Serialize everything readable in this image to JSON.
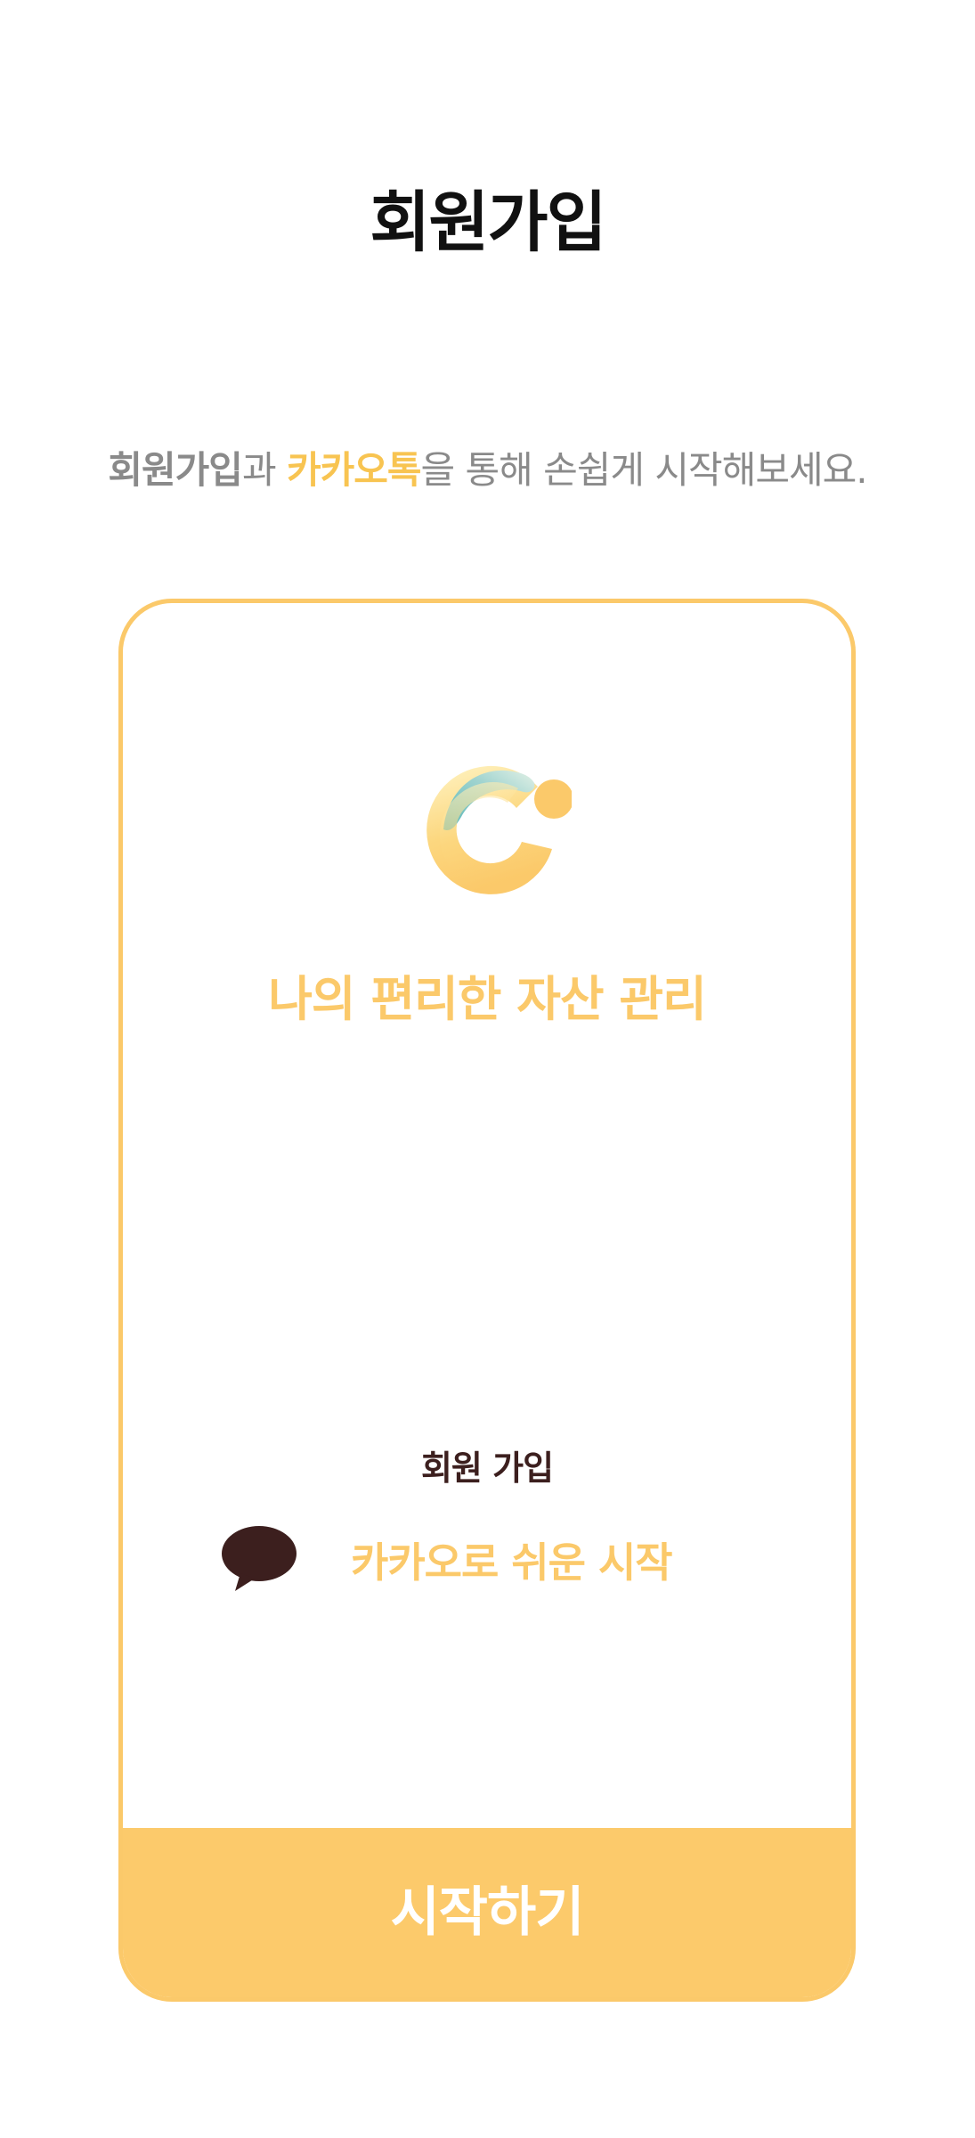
{
  "header": {
    "title": "회원가입"
  },
  "intro": {
    "part1": "회원가입",
    "part2": "과 ",
    "part3": "카카오톡",
    "part4": "을 통해 손쉽게 시작해보세요."
  },
  "card": {
    "logo_icon": "app-logo-icon",
    "slogan": "나의 편리한 자산 관리",
    "signup_label": "회원 가입",
    "kakao_icon": "speech-bubble-icon",
    "kakao_text": "카카오로 쉬운 시작",
    "start_button_label": "시작하기"
  },
  "colors": {
    "accent": "#fbc96a",
    "kakao_brown": "#3c1f1e",
    "subtitle_gray": "#8a8a8a",
    "logo_teal": "#7fc6c6"
  }
}
